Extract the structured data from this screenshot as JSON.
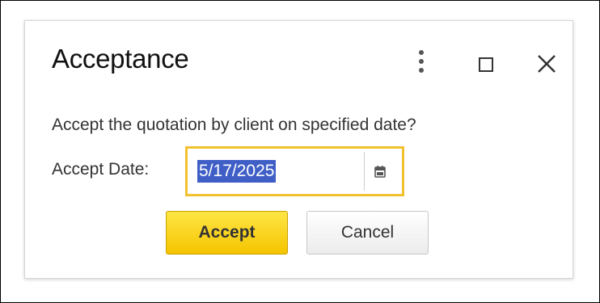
{
  "dialog": {
    "title": "Acceptance",
    "message": "Accept the quotation by client on specified date?",
    "title_bar_icons": {
      "menu": "kebab-menu-icon",
      "maximize": "maximize-icon",
      "close": "close-icon"
    }
  },
  "accept_date": {
    "label": "Accept Date:",
    "value": "5/17/2025",
    "value_selected": true,
    "picker_icon": "calendar-icon"
  },
  "buttons": {
    "accept": "Accept",
    "cancel": "Cancel"
  },
  "colors": {
    "focus_border": "#f2c12e",
    "selection_highlight": "#3f5fc7",
    "primary_button": "#f4c400"
  }
}
